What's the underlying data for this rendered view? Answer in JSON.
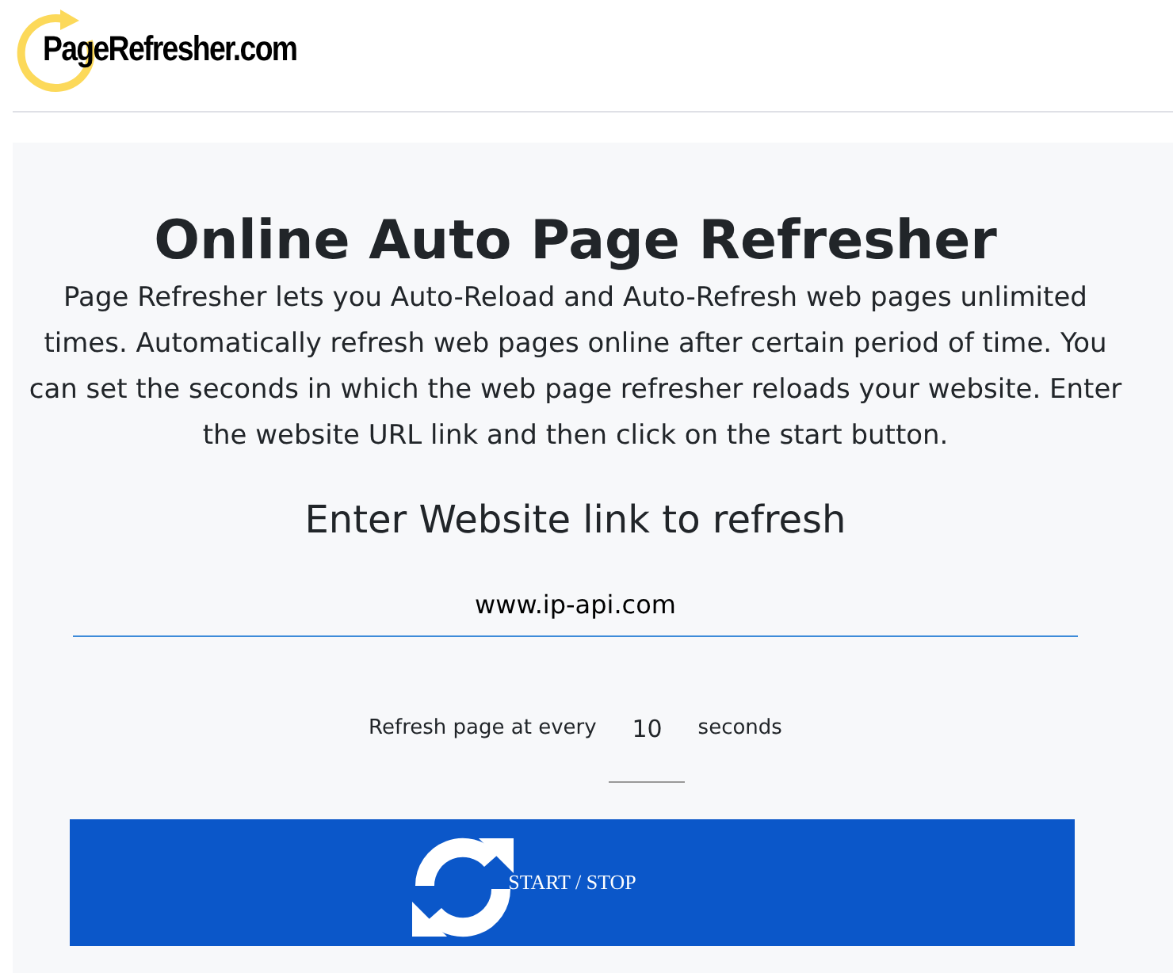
{
  "logo": {
    "text": "PageRefresher.com"
  },
  "title": "Online Auto Page Refresher",
  "description": "Page Refresher lets you Auto-Reload and Auto-Refresh web pages unlimited times. Automatically refresh web pages online after certain period of time. You can set the seconds in which the web page refresher reloads your website. Enter the website URL link and then click on the start button.",
  "subheading": "Enter Website link to refresh",
  "url_field": {
    "value": "www.ip-api.com"
  },
  "interval": {
    "prefix": "Refresh page at every",
    "value": "10",
    "suffix": "seconds"
  },
  "button": {
    "label": "START / STOP"
  }
}
